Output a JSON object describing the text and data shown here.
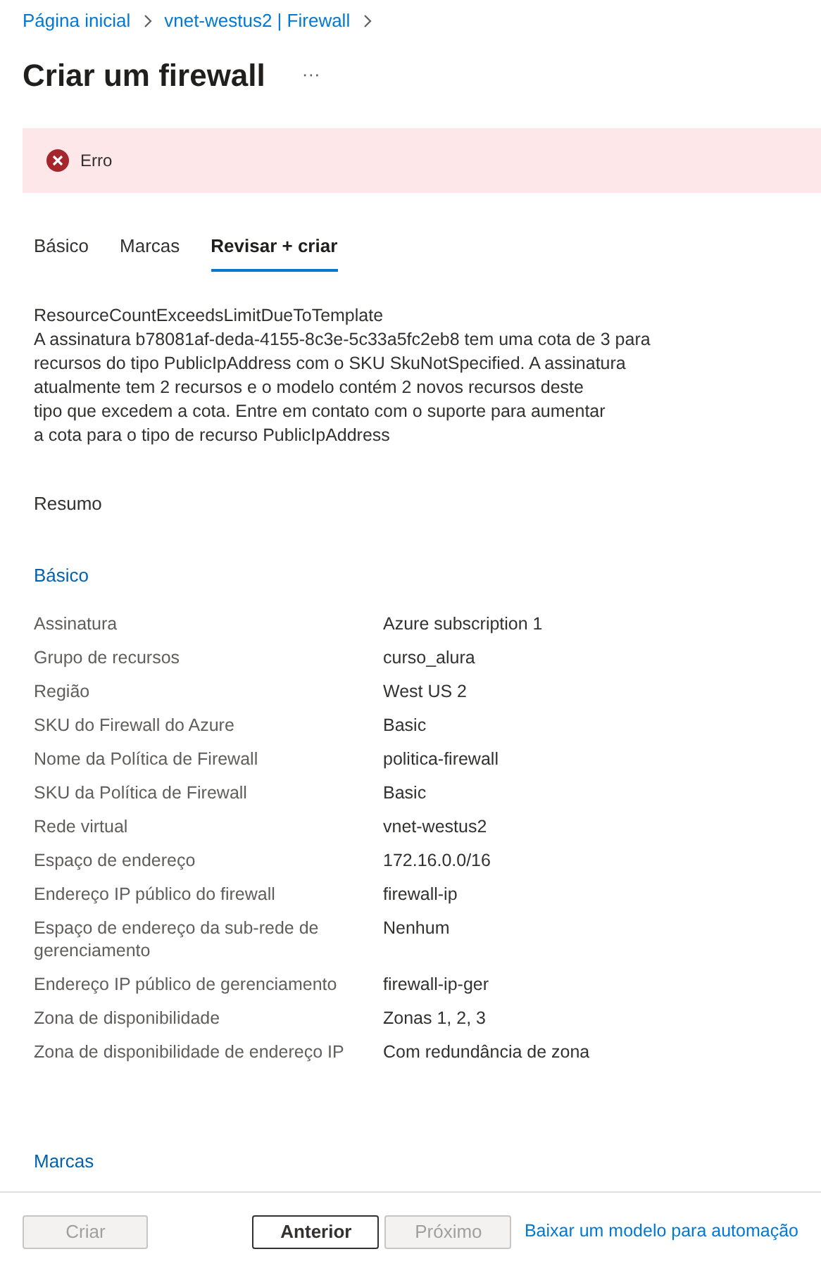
{
  "breadcrumb": [
    "Página inicial",
    "vnet-westus2 | Firewall"
  ],
  "title": "Criar um firewall",
  "more_button": "···",
  "error_banner": {
    "label": "Erro"
  },
  "tabs": [
    {
      "label": "Básico",
      "selected": false
    },
    {
      "label": "Marcas",
      "selected": false
    },
    {
      "label": "Revisar + criar",
      "selected": true
    }
  ],
  "error_detail": {
    "code": "ResourceCountExceedsLimitDueToTemplate",
    "lines": [
      "A assinatura b78081af-deda-4155-8c3e-5c33a5fc2eb8 tem uma cota de 3 para",
      "recursos do tipo PublicIpAddress com o SKU SkuNotSpecified. A assinatura",
      "atualmente tem 2 recursos e o modelo contém 2 novos recursos deste",
      "tipo que excedem a cota. Entre em contato com o suporte para aumentar",
      "a cota para o tipo de recurso PublicIpAddress"
    ]
  },
  "summary_title": "Resumo",
  "sections": [
    {
      "title": "Básico",
      "rows": [
        {
          "label": "Assinatura",
          "value": "Azure subscription 1"
        },
        {
          "label": "Grupo de recursos",
          "value": "curso_alura"
        },
        {
          "label": "Região",
          "value": "West US 2"
        },
        {
          "label": "SKU do Firewall do Azure",
          "value": "Basic"
        },
        {
          "label": "Nome da Política de Firewall",
          "value": "politica-firewall"
        },
        {
          "label": "SKU da Política de Firewall",
          "value": "Basic"
        },
        {
          "label": "Rede virtual",
          "value": "vnet-westus2"
        },
        {
          "label": "Espaço de endereço",
          "value": "172.16.0.0/16"
        },
        {
          "label": "Endereço IP público do firewall",
          "value": "firewall-ip"
        },
        {
          "label": "Espaço de endereço da sub-rede de gerenciamento",
          "value": "Nenhum"
        },
        {
          "label": "Endereço IP público de gerenciamento",
          "value": "firewall-ip-ger"
        },
        {
          "label": "Zona de disponibilidade",
          "value": "Zonas 1, 2, 3"
        },
        {
          "label": "Zona de disponibilidade de endereço IP",
          "value": "Com redundância de zona"
        }
      ]
    },
    {
      "title": "Marcas"
    }
  ],
  "footer": {
    "buttons": [
      {
        "label": "Criar",
        "disabled": true
      },
      {
        "label": "Anterior",
        "disabled": false
      },
      {
        "label": "Próximo",
        "disabled": true
      }
    ],
    "link": "Baixar um modelo para automação"
  }
}
